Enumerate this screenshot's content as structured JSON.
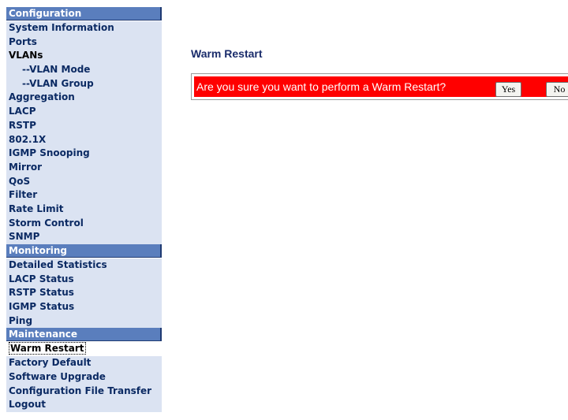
{
  "sidebar": {
    "configuration": {
      "header": "Configuration",
      "items": [
        "System Information",
        "Ports",
        "VLANs",
        "--VLAN Mode",
        "--VLAN Group",
        "Aggregation",
        "LACP",
        "RSTP",
        "802.1X",
        "IGMP Snooping",
        "Mirror",
        "QoS",
        "Filter",
        "Rate Limit",
        "Storm Control",
        "SNMP"
      ]
    },
    "monitoring": {
      "header": "Monitoring",
      "items": [
        "Detailed Statistics",
        "LACP Status",
        "RSTP Status",
        "IGMP Status",
        "Ping"
      ]
    },
    "maintenance": {
      "header": "Maintenance",
      "items": [
        "Warm Restart",
        "Factory Default",
        "Software Upgrade",
        "Configuration File Transfer",
        "Logout"
      ]
    }
  },
  "main": {
    "title": "Warm Restart",
    "confirm_text": "Are you sure you want to perform a Warm Restart?",
    "yes_label": "Yes",
    "no_label": "No"
  },
  "colors": {
    "header_bg": "#5a7ebd",
    "item_bg": "#dbe3f2",
    "alert_bg": "#ff0000",
    "title_color": "#1a2c6b"
  }
}
